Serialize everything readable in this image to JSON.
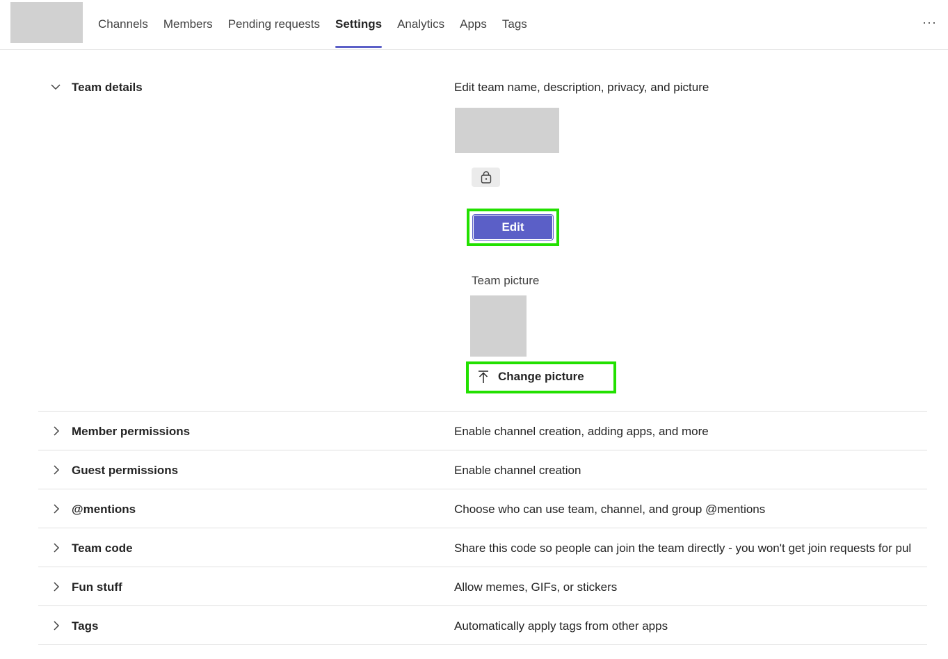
{
  "tabs": [
    {
      "label": "Channels"
    },
    {
      "label": "Members"
    },
    {
      "label": "Pending requests"
    },
    {
      "label": "Settings",
      "active": true
    },
    {
      "label": "Analytics"
    },
    {
      "label": "Apps"
    },
    {
      "label": "Tags"
    }
  ],
  "more_label": "···",
  "team_details": {
    "title": "Team details",
    "description": "Edit team name, description, privacy, and picture",
    "edit_label": "Edit",
    "picture_label": "Team picture",
    "change_picture_label": "Change picture"
  },
  "sections": [
    {
      "title": "Member permissions",
      "description": "Enable channel creation, adding apps, and more"
    },
    {
      "title": "Guest permissions",
      "description": "Enable channel creation"
    },
    {
      "title": "@mentions",
      "description": "Choose who can use team, channel, and group @mentions"
    },
    {
      "title": "Team code",
      "description": "Share this code so people can join the team directly - you won't get join requests for pul"
    },
    {
      "title": "Fun stuff",
      "description": "Allow memes, GIFs, or stickers"
    },
    {
      "title": "Tags",
      "description": "Automatically apply tags from other apps"
    }
  ],
  "colors": {
    "accent": "#5b5fc7",
    "highlight": "#22e000",
    "placeholder": "#d1d1d1"
  },
  "icons": {
    "expanded": "chevron-down-icon",
    "collapsed": "chevron-right-icon",
    "privacy": "lock-icon",
    "upload": "upload-icon",
    "more": "more-icon"
  }
}
